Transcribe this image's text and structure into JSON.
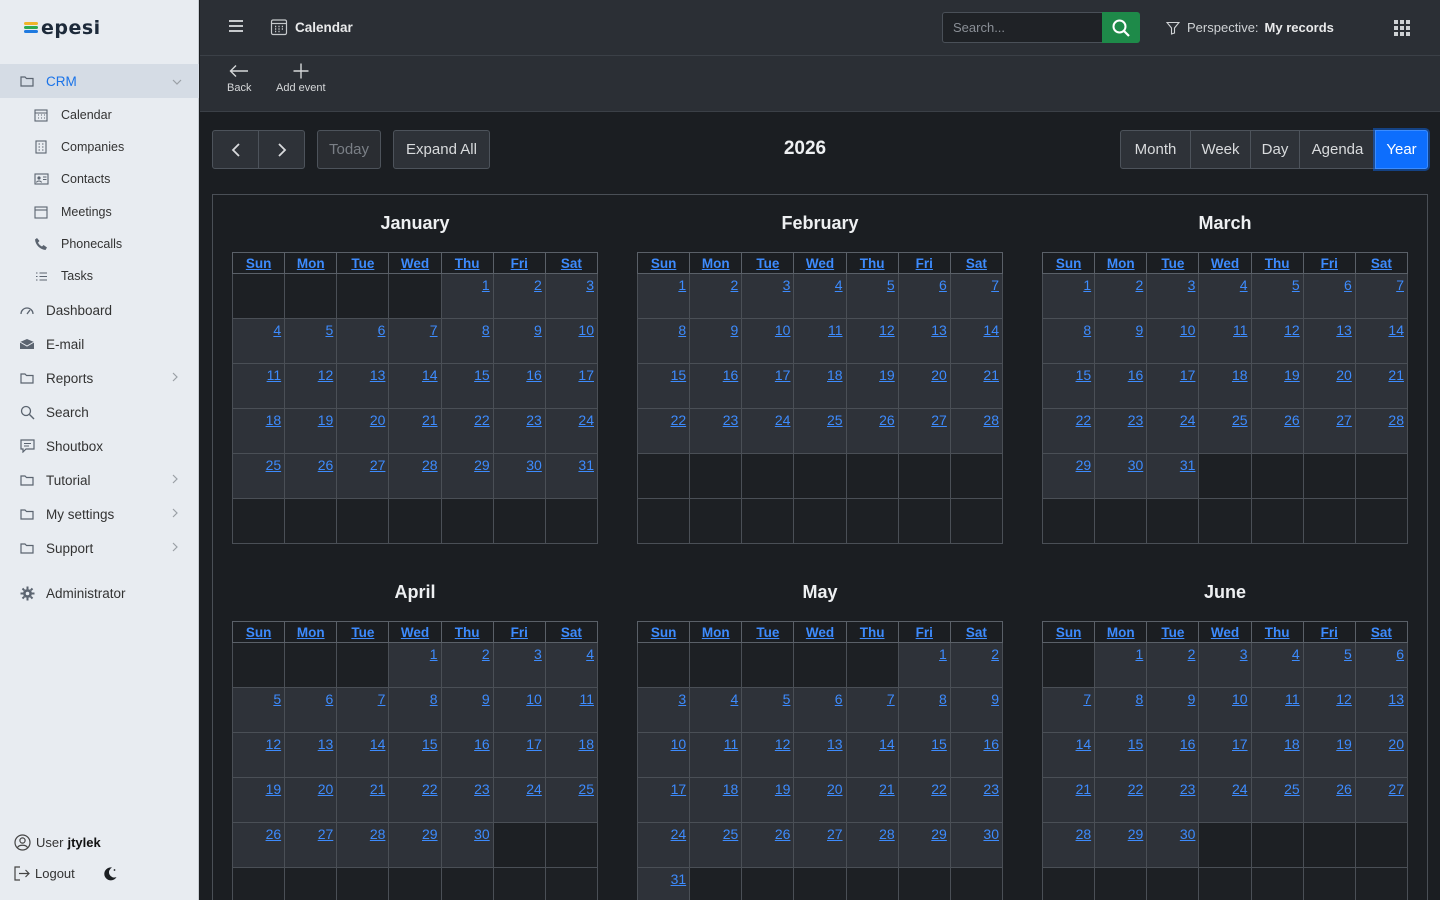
{
  "brand": {
    "name": "epesi",
    "colors": [
      "#f0b429",
      "#2eaa4f",
      "#1f7ae0"
    ]
  },
  "sidebar": {
    "items": [
      {
        "label": "CRM",
        "icon": "folder-icon",
        "active": true,
        "has_children": true
      },
      {
        "label": "Dashboard",
        "icon": "dashboard-icon"
      },
      {
        "label": "E-mail",
        "icon": "envelope-icon"
      },
      {
        "label": "Reports",
        "icon": "folder-icon",
        "has_children": true
      },
      {
        "label": "Search",
        "icon": "search-icon"
      },
      {
        "label": "Shoutbox",
        "icon": "chat-icon"
      },
      {
        "label": "Tutorial",
        "icon": "folder-icon",
        "has_children": true
      },
      {
        "label": "My settings",
        "icon": "folder-icon",
        "has_children": true
      },
      {
        "label": "Support",
        "icon": "folder-icon",
        "has_children": true
      },
      {
        "label": "Administrator",
        "icon": "gear-icon"
      }
    ],
    "crm_children": [
      {
        "label": "Calendar",
        "icon": "calendar-icon"
      },
      {
        "label": "Companies",
        "icon": "building-icon"
      },
      {
        "label": "Contacts",
        "icon": "contact-card-icon"
      },
      {
        "label": "Meetings",
        "icon": "window-icon"
      },
      {
        "label": "Phonecalls",
        "icon": "phone-icon"
      },
      {
        "label": "Tasks",
        "icon": "list-icon"
      }
    ],
    "user_label": "User",
    "username": "jtylek",
    "logout_label": "Logout"
  },
  "topbar": {
    "title": "Calendar",
    "search_placeholder": "Search...",
    "perspective_label": "Perspective:",
    "perspective_value": "My records"
  },
  "actions": {
    "back": "Back",
    "add_event": "Add event"
  },
  "calendar": {
    "today_label": "Today",
    "expand_label": "Expand All",
    "year": "2026",
    "views": [
      "Month",
      "Week",
      "Day",
      "Agenda",
      "Year"
    ],
    "active_view": "Year",
    "weekdays": [
      "Sun",
      "Mon",
      "Tue",
      "Wed",
      "Thu",
      "Fri",
      "Sat"
    ],
    "months": [
      {
        "name": "January",
        "start": 4,
        "days": 31
      },
      {
        "name": "February",
        "start": 0,
        "days": 28
      },
      {
        "name": "March",
        "start": 0,
        "days": 31
      },
      {
        "name": "April",
        "start": 3,
        "days": 30
      },
      {
        "name": "May",
        "start": 5,
        "days": 31
      },
      {
        "name": "June",
        "start": 1,
        "days": 30
      }
    ]
  },
  "colors": {
    "accent": "#0d6efd",
    "link": "#3d8bfd",
    "search_button": "#1e8a49"
  }
}
